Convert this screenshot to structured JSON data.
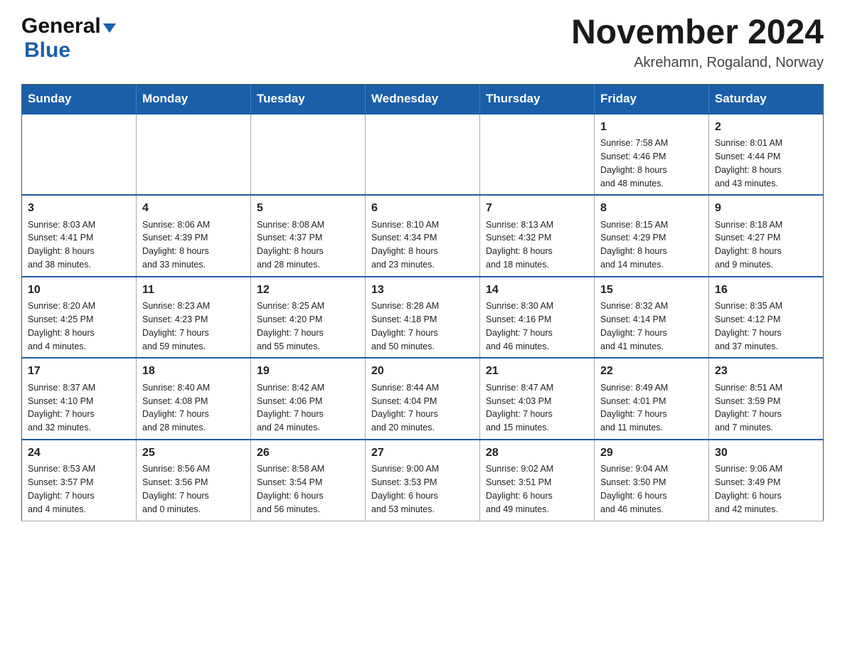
{
  "header": {
    "title": "November 2024",
    "location": "Akrehamn, Rogaland, Norway",
    "logo_general": "General",
    "logo_blue": "Blue"
  },
  "weekdays": [
    "Sunday",
    "Monday",
    "Tuesday",
    "Wednesday",
    "Thursday",
    "Friday",
    "Saturday"
  ],
  "weeks": [
    [
      {
        "day": "",
        "info": ""
      },
      {
        "day": "",
        "info": ""
      },
      {
        "day": "",
        "info": ""
      },
      {
        "day": "",
        "info": ""
      },
      {
        "day": "",
        "info": ""
      },
      {
        "day": "1",
        "info": "Sunrise: 7:58 AM\nSunset: 4:46 PM\nDaylight: 8 hours\nand 48 minutes."
      },
      {
        "day": "2",
        "info": "Sunrise: 8:01 AM\nSunset: 4:44 PM\nDaylight: 8 hours\nand 43 minutes."
      }
    ],
    [
      {
        "day": "3",
        "info": "Sunrise: 8:03 AM\nSunset: 4:41 PM\nDaylight: 8 hours\nand 38 minutes."
      },
      {
        "day": "4",
        "info": "Sunrise: 8:06 AM\nSunset: 4:39 PM\nDaylight: 8 hours\nand 33 minutes."
      },
      {
        "day": "5",
        "info": "Sunrise: 8:08 AM\nSunset: 4:37 PM\nDaylight: 8 hours\nand 28 minutes."
      },
      {
        "day": "6",
        "info": "Sunrise: 8:10 AM\nSunset: 4:34 PM\nDaylight: 8 hours\nand 23 minutes."
      },
      {
        "day": "7",
        "info": "Sunrise: 8:13 AM\nSunset: 4:32 PM\nDaylight: 8 hours\nand 18 minutes."
      },
      {
        "day": "8",
        "info": "Sunrise: 8:15 AM\nSunset: 4:29 PM\nDaylight: 8 hours\nand 14 minutes."
      },
      {
        "day": "9",
        "info": "Sunrise: 8:18 AM\nSunset: 4:27 PM\nDaylight: 8 hours\nand 9 minutes."
      }
    ],
    [
      {
        "day": "10",
        "info": "Sunrise: 8:20 AM\nSunset: 4:25 PM\nDaylight: 8 hours\nand 4 minutes."
      },
      {
        "day": "11",
        "info": "Sunrise: 8:23 AM\nSunset: 4:23 PM\nDaylight: 7 hours\nand 59 minutes."
      },
      {
        "day": "12",
        "info": "Sunrise: 8:25 AM\nSunset: 4:20 PM\nDaylight: 7 hours\nand 55 minutes."
      },
      {
        "day": "13",
        "info": "Sunrise: 8:28 AM\nSunset: 4:18 PM\nDaylight: 7 hours\nand 50 minutes."
      },
      {
        "day": "14",
        "info": "Sunrise: 8:30 AM\nSunset: 4:16 PM\nDaylight: 7 hours\nand 46 minutes."
      },
      {
        "day": "15",
        "info": "Sunrise: 8:32 AM\nSunset: 4:14 PM\nDaylight: 7 hours\nand 41 minutes."
      },
      {
        "day": "16",
        "info": "Sunrise: 8:35 AM\nSunset: 4:12 PM\nDaylight: 7 hours\nand 37 minutes."
      }
    ],
    [
      {
        "day": "17",
        "info": "Sunrise: 8:37 AM\nSunset: 4:10 PM\nDaylight: 7 hours\nand 32 minutes."
      },
      {
        "day": "18",
        "info": "Sunrise: 8:40 AM\nSunset: 4:08 PM\nDaylight: 7 hours\nand 28 minutes."
      },
      {
        "day": "19",
        "info": "Sunrise: 8:42 AM\nSunset: 4:06 PM\nDaylight: 7 hours\nand 24 minutes."
      },
      {
        "day": "20",
        "info": "Sunrise: 8:44 AM\nSunset: 4:04 PM\nDaylight: 7 hours\nand 20 minutes."
      },
      {
        "day": "21",
        "info": "Sunrise: 8:47 AM\nSunset: 4:03 PM\nDaylight: 7 hours\nand 15 minutes."
      },
      {
        "day": "22",
        "info": "Sunrise: 8:49 AM\nSunset: 4:01 PM\nDaylight: 7 hours\nand 11 minutes."
      },
      {
        "day": "23",
        "info": "Sunrise: 8:51 AM\nSunset: 3:59 PM\nDaylight: 7 hours\nand 7 minutes."
      }
    ],
    [
      {
        "day": "24",
        "info": "Sunrise: 8:53 AM\nSunset: 3:57 PM\nDaylight: 7 hours\nand 4 minutes."
      },
      {
        "day": "25",
        "info": "Sunrise: 8:56 AM\nSunset: 3:56 PM\nDaylight: 7 hours\nand 0 minutes."
      },
      {
        "day": "26",
        "info": "Sunrise: 8:58 AM\nSunset: 3:54 PM\nDaylight: 6 hours\nand 56 minutes."
      },
      {
        "day": "27",
        "info": "Sunrise: 9:00 AM\nSunset: 3:53 PM\nDaylight: 6 hours\nand 53 minutes."
      },
      {
        "day": "28",
        "info": "Sunrise: 9:02 AM\nSunset: 3:51 PM\nDaylight: 6 hours\nand 49 minutes."
      },
      {
        "day": "29",
        "info": "Sunrise: 9:04 AM\nSunset: 3:50 PM\nDaylight: 6 hours\nand 46 minutes."
      },
      {
        "day": "30",
        "info": "Sunrise: 9:06 AM\nSunset: 3:49 PM\nDaylight: 6 hours\nand 42 minutes."
      }
    ]
  ]
}
